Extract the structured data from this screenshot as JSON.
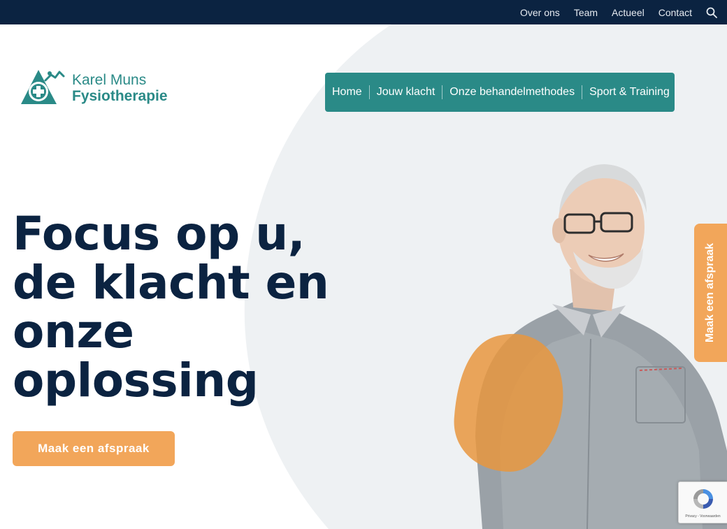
{
  "topnav": {
    "links": [
      "Over ons",
      "Team",
      "Actueel",
      "Contact"
    ],
    "search_icon": "search-icon"
  },
  "logo": {
    "line1": "Karel Muns",
    "line2": "Fysiotherapie",
    "color": "#2a8a87"
  },
  "mainnav": {
    "items": [
      "Home",
      "Jouw klacht",
      "Onze behandelmethodes",
      "Sport & Training"
    ]
  },
  "hero": {
    "title_lines": [
      "Focus op u,",
      "de klacht en",
      "onze",
      "oplossing"
    ],
    "cta_label": "Maak een afspraak"
  },
  "sidetab": {
    "label": "Maak een afspraak"
  },
  "recaptcha": {
    "text": "Privacy - Voorwaarden"
  },
  "colors": {
    "navy": "#0b2341",
    "teal": "#2a8a87",
    "orange": "#f2a65a",
    "light_gray": "#eef1f3"
  }
}
